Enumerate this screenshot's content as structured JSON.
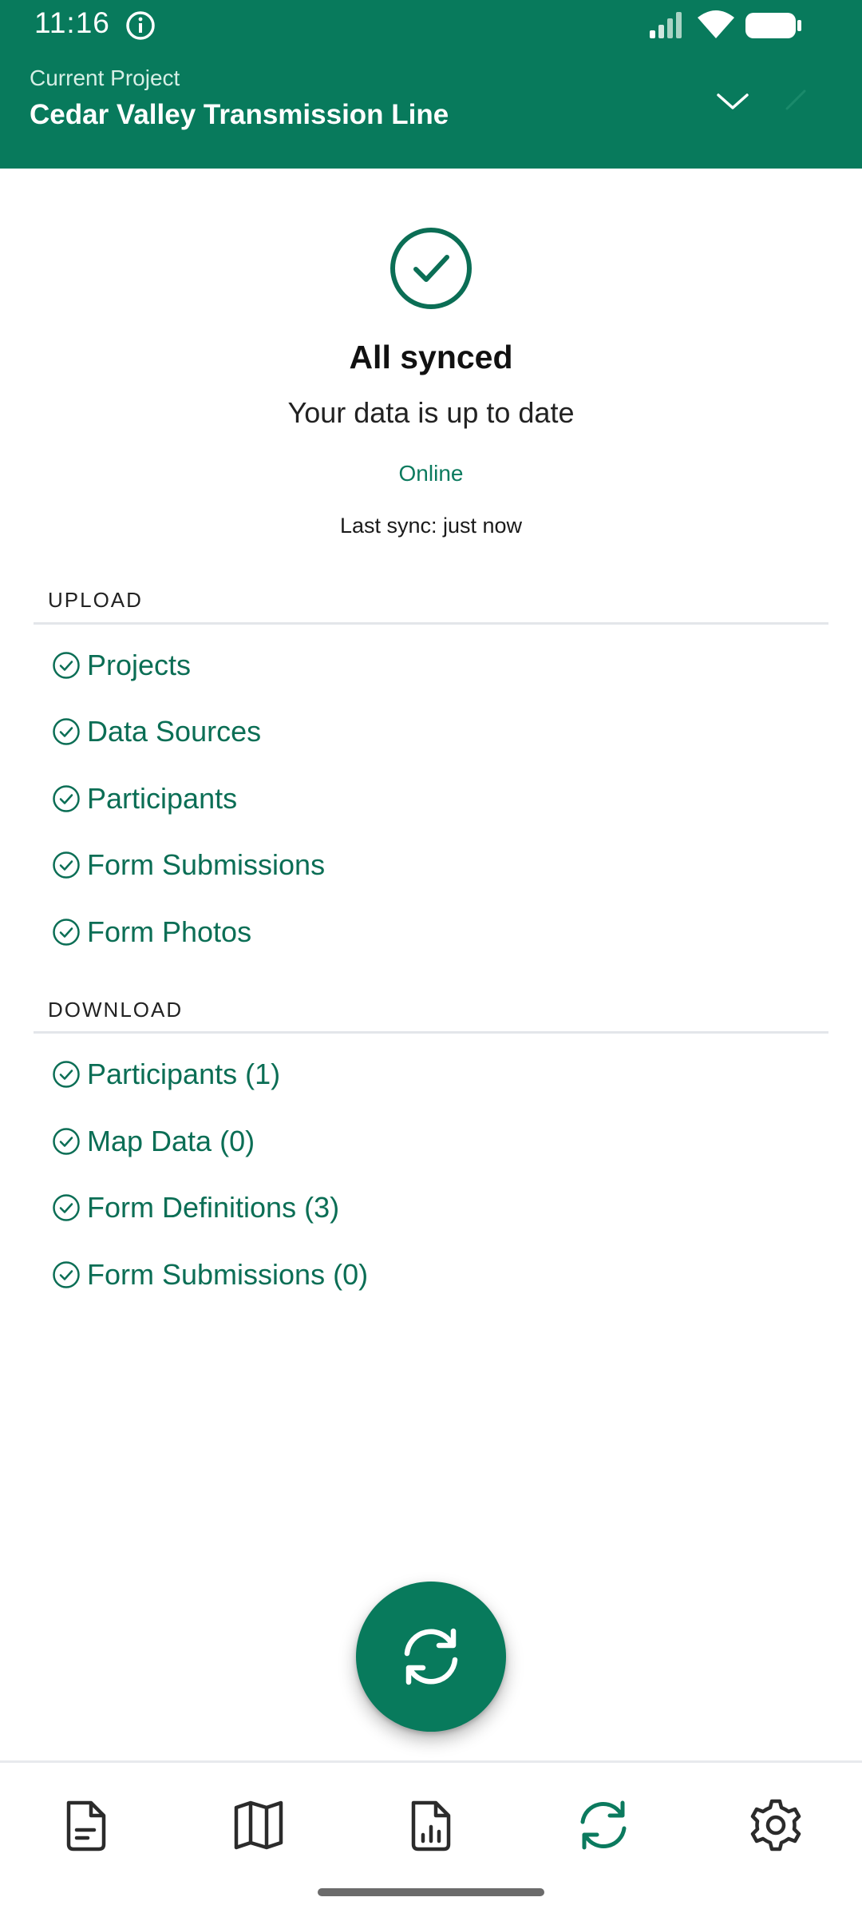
{
  "status_bar": {
    "time": "11:16",
    "icons": [
      "info-icon",
      "signal-icon",
      "wifi-icon",
      "battery-icon"
    ]
  },
  "header": {
    "caption": "Current Project",
    "project_name": "Cedar Valley Transmission Line",
    "dropdown_icon": "chevron-down-icon"
  },
  "sync": {
    "status_icon": "check-circle-icon",
    "title": "All synced",
    "subtitle": "Your data is up to date",
    "connection": "Online",
    "last_sync": "Last sync: just now"
  },
  "upload": {
    "header": "UPLOAD",
    "items": [
      {
        "label": "Projects"
      },
      {
        "label": "Data Sources"
      },
      {
        "label": "Participants"
      },
      {
        "label": "Form Submissions"
      },
      {
        "label": "Form Photos"
      }
    ]
  },
  "download": {
    "header": "DOWNLOAD",
    "items": [
      {
        "label": "Participants (1)"
      },
      {
        "label": "Map Data (0)"
      },
      {
        "label": "Form Definitions (3)"
      },
      {
        "label": "Form Submissions (0)"
      }
    ]
  },
  "fab": {
    "icon": "sync-icon"
  },
  "bottom_nav": {
    "items": [
      {
        "icon": "document-icon"
      },
      {
        "icon": "map-icon"
      },
      {
        "icon": "report-icon"
      },
      {
        "icon": "sync-icon",
        "active": true
      },
      {
        "icon": "settings-icon"
      }
    ]
  },
  "colors": {
    "primary": "#087a5c",
    "accent_text": "#0b6e55",
    "nav_inactive": "#2b2b2b"
  }
}
